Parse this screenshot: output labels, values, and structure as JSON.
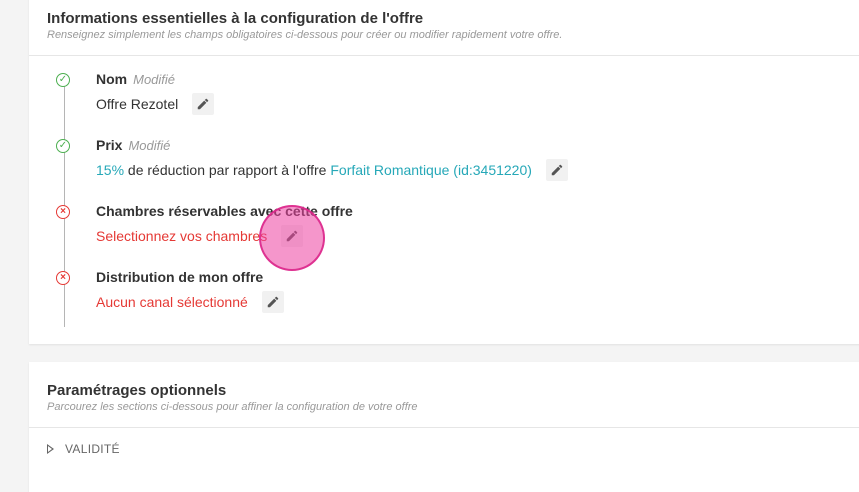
{
  "essential": {
    "title": "Informations essentielles à la configuration de l'offre",
    "subtitle": "Renseignez simplement les champs obligatoires ci-dessous pour créer ou modifier rapidement votre offre.",
    "steps": [
      {
        "status": "ok",
        "title": "Nom",
        "modified": "Modifié",
        "value": "Offre Rezotel"
      },
      {
        "status": "ok",
        "title": "Prix",
        "modified": "Modifié",
        "value_percent": "15%",
        "value_text": " de réduction par rapport à l'offre ",
        "value_link": "Forfait Romantique (id:3451220)"
      },
      {
        "status": "error",
        "title": "Chambres réservables avec cette offre",
        "value": "Selectionnez vos chambres"
      },
      {
        "status": "error",
        "title": "Distribution de mon offre",
        "value": "Aucun canal sélectionné"
      }
    ]
  },
  "optional": {
    "title": "Paramétrages optionnels",
    "subtitle": "Parcourez les sections ci-dessous pour affiner la configuration de votre offre",
    "sections": [
      {
        "label": "VALIDITÉ"
      }
    ]
  },
  "icons": {
    "ok": "check-circle-icon",
    "error": "x-circle-icon",
    "edit": "pencil-icon",
    "expand": "triangle-right-icon"
  },
  "colors": {
    "success": "#4caf50",
    "error": "#e53935",
    "link": "#26a8b8",
    "click_indicator": "#ec40a0"
  }
}
